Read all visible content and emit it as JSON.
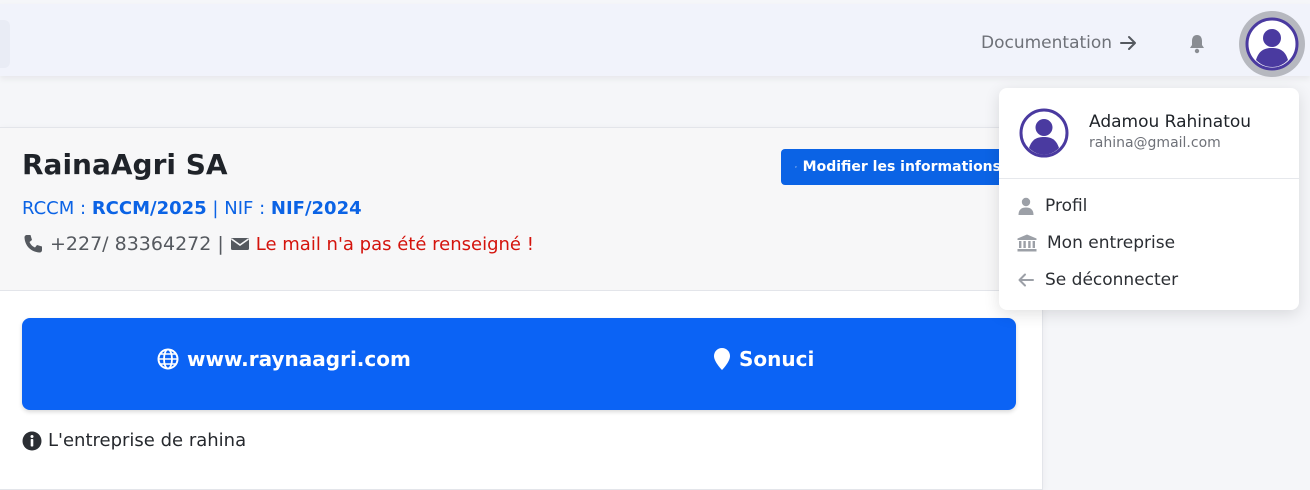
{
  "header": {
    "documentation_label": "Documentation",
    "icons": [
      "arrow-right-icon",
      "bell-icon",
      "user-avatar-icon"
    ]
  },
  "company": {
    "name": "RainaAgri SA",
    "rccm_label": "RCCM :",
    "rccm_value": "RCCM/2025",
    "separator": "|",
    "nif_label": "NIF :",
    "nif_value": "NIF/2024",
    "phone": "+227/ 83364272",
    "mail_missing": "Le mail n'a pas été renseigné !",
    "edit_button": "Modifier les informations",
    "website": "www.raynaagri.com",
    "location": "Sonuci",
    "description": "L'entreprise de rahina"
  },
  "user_menu": {
    "name": "Adamou Rahinatou",
    "email": "rahina@gmail.com",
    "items": [
      {
        "label": "Profil",
        "icon": "user-icon"
      },
      {
        "label": "Mon entreprise",
        "icon": "bank-icon"
      },
      {
        "label": "Se déconnecter",
        "icon": "arrow-left-icon"
      }
    ]
  },
  "colors": {
    "primary": "#0b63e5",
    "band": "#0b63f5",
    "danger": "#d4130c",
    "avatar": "#4a3aa0"
  }
}
